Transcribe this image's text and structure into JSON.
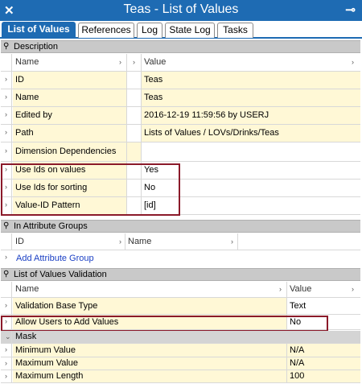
{
  "window": {
    "title": "Teas - List of Values"
  },
  "tabs": [
    "List of Values",
    "References",
    "Log",
    "State Log",
    "Tasks"
  ],
  "description": {
    "section_label": "Description",
    "col_name": "Name",
    "col_value": "Value",
    "rows": [
      {
        "name": "ID",
        "value": "Teas"
      },
      {
        "name": "Name",
        "value": "Teas"
      },
      {
        "name": "Edited by",
        "value": "2016-12-19 11:59:56 by USERJ"
      },
      {
        "name": "Path",
        "value": "Lists of Values / LOVs/Drinks/Teas"
      },
      {
        "name": "Dimension Dependencies",
        "value": ""
      },
      {
        "name": "Use Ids on values",
        "value": "Yes"
      },
      {
        "name": "Use Ids for sorting",
        "value": "No"
      },
      {
        "name": "Value-ID Pattern",
        "value": "[id]"
      }
    ]
  },
  "attribute_groups": {
    "section_label": "In Attribute Groups",
    "col_id": "ID",
    "col_name": "Name",
    "add_link": "Add Attribute Group"
  },
  "validation": {
    "section_label": "List of Values Validation",
    "col_name": "Name",
    "col_value": "Value",
    "rows": [
      {
        "name": "Validation Base Type",
        "value": "Text"
      },
      {
        "name": "Allow Users to Add Values",
        "value": "No"
      }
    ],
    "mask_label": "Mask",
    "mask_rows": [
      {
        "name": "Minimum Value",
        "value": "N/A"
      },
      {
        "name": "Maximum Value",
        "value": "N/A"
      },
      {
        "name": "Maximum Length",
        "value": "100"
      }
    ]
  },
  "colors": {
    "accent": "#1e6bb3",
    "highlight": "#8b1a2a",
    "row_bg": "#fff8d6",
    "section_bg": "#c9c9c9"
  }
}
